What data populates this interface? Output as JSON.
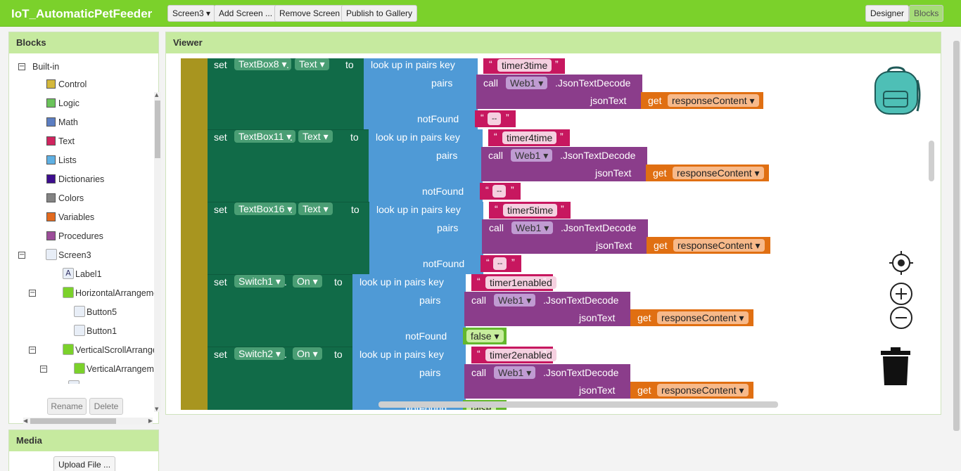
{
  "app": {
    "title": "IoT_AutomaticPetFeeder"
  },
  "toolbar": {
    "screen": "Screen3 ▾",
    "add": "Add Screen ...",
    "remove": "Remove Screen",
    "publish": "Publish to Gallery",
    "designer": "Designer",
    "blocks": "Blocks"
  },
  "blocks_panel": {
    "title": "Blocks",
    "builtin": "Built-in",
    "categories": [
      {
        "label": "Control",
        "color": "#d4b83c"
      },
      {
        "label": "Logic",
        "color": "#6bc35a"
      },
      {
        "label": "Math",
        "color": "#5c7ec2"
      },
      {
        "label": "Text",
        "color": "#d0245f"
      },
      {
        "label": "Lists",
        "color": "#5fb0e3"
      },
      {
        "label": "Dictionaries",
        "color": "#3d0d8e"
      },
      {
        "label": "Colors",
        "color": "#838383"
      },
      {
        "label": "Variables",
        "color": "#e36a1e"
      },
      {
        "label": "Procedures",
        "color": "#9c4d99"
      }
    ],
    "components": [
      "Screen3",
      "Label1",
      "HorizontalArrangemen",
      "Button5",
      "Button1",
      "VerticalScrollArrangem",
      "VerticalArrangemen"
    ],
    "rename": "Rename",
    "delete": "Delete"
  },
  "media": {
    "title": "Media",
    "upload": "Upload File ..."
  },
  "viewer": {
    "title": "Viewer"
  },
  "words": {
    "set": "set",
    "to": "to",
    "dot": ".",
    "lookup": "look up in pairs  key",
    "pairs": "pairs",
    "notFound": "notFound",
    "call": "call",
    "jsonTextDecode": ".JsonTextDecode",
    "jsonText": "jsonText",
    "get": "get",
    "q1": "“",
    "q2": "”"
  },
  "rows": [
    {
      "comp": "TextBox8 ▾",
      "prop": "Text ▾",
      "key": "timer3time",
      "web": "Web1 ▾",
      "var": "responseContent ▾",
      "nf": "--"
    },
    {
      "comp": "TextBox11 ▾",
      "prop": "Text ▾",
      "key": "timer4time",
      "web": "Web1 ▾",
      "var": "responseContent ▾",
      "nf": "--"
    },
    {
      "comp": "TextBox16 ▾",
      "prop": "Text ▾",
      "key": "timer5time",
      "web": "Web1 ▾",
      "var": "responseContent ▾",
      "nf": "--"
    },
    {
      "comp": "Switch1 ▾",
      "prop": "On ▾",
      "key": "timer1enabled",
      "web": "Web1 ▾",
      "var": "responseContent ▾",
      "nf": "false ▾"
    },
    {
      "comp": "Switch2 ▾",
      "prop": "On ▾",
      "key": "timer2enabled",
      "web": "Web1 ▾",
      "var": "responseContent ▾",
      "nf": "false"
    }
  ],
  "colors": {
    "topbar": "#7bd12b",
    "set_block": "#116b48",
    "lookup": "#4f9ad6",
    "call": "#8b3d8b",
    "text": "#c7175f",
    "get": "#e06f12",
    "logic": "#64b82d",
    "event": "#a8951f"
  }
}
